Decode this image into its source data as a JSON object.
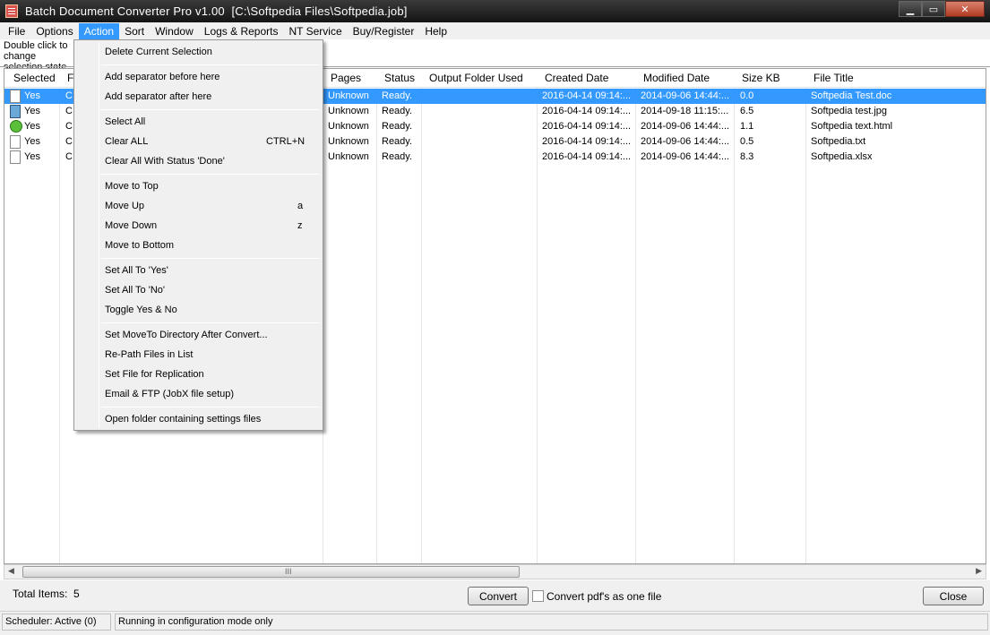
{
  "window": {
    "title": "Batch Document Converter Pro v1.00  [C:\\Softpedia Files\\Softpedia.job]",
    "minimize": "▁",
    "maximize": "▭",
    "close": "✕"
  },
  "menu": [
    "File",
    "Options",
    "Action",
    "Sort",
    "Window",
    "Logs & Reports",
    "NT Service",
    "Buy/Register",
    "Help"
  ],
  "hint": "Double click to change selection state",
  "columns": {
    "selected": "Selected",
    "file": "F",
    "pages": "Pages",
    "status": "Status",
    "output": "Output Folder Used",
    "created": "Created Date",
    "modified": "Modified Date",
    "size": "Size KB",
    "title": "File Title"
  },
  "rows": [
    {
      "selected": "Yes",
      "file": "C:",
      "pages": "Unknown",
      "status": "Ready.",
      "output": "",
      "created": "2016-04-14 09:14:...",
      "modified": "2014-09-06 14:44:...",
      "size": "0.0",
      "title": "Softpedia Test.doc",
      "icon": "doc-icon"
    },
    {
      "selected": "Yes",
      "file": "C:",
      "pages": "Unknown",
      "status": "Ready.",
      "output": "",
      "created": "2016-04-14 09:14:...",
      "modified": "2014-09-18 11:15:...",
      "size": "6.5",
      "title": "Softpedia test.jpg",
      "icon": "image-icon"
    },
    {
      "selected": "Yes",
      "file": "C:",
      "pages": "Unknown",
      "status": "Ready.",
      "output": "",
      "created": "2016-04-14 09:14:...",
      "modified": "2014-09-06 14:44:...",
      "size": "1.1",
      "title": "Softpedia text.html",
      "icon": "html-icon"
    },
    {
      "selected": "Yes",
      "file": "C:",
      "pages": "Unknown",
      "status": "Ready.",
      "output": "",
      "created": "2016-04-14 09:14:...",
      "modified": "2014-09-06 14:44:...",
      "size": "0.5",
      "title": "Softpedia.txt",
      "icon": "text-icon"
    },
    {
      "selected": "Yes",
      "file": "C:",
      "pages": "Unknown",
      "status": "Ready.",
      "output": "",
      "created": "2016-04-14 09:14:...",
      "modified": "2014-09-06 14:44:...",
      "size": "8.3",
      "title": "Softpedia.xlsx",
      "icon": "sheet-icon"
    }
  ],
  "scroll_grip": "III",
  "footer": {
    "total_label": "Total Items:",
    "total_value": "5",
    "convert": "Convert",
    "convert_pdf": "Convert pdf's as one file",
    "close": "Close"
  },
  "status": {
    "scheduler": "Scheduler: Active (0)",
    "mode": "Running in configuration mode only"
  },
  "action_menu": {
    "delete_selection": "Delete Current Selection",
    "sep_before": "Add separator before here",
    "sep_after": "Add separator after here",
    "select_all": "Select All",
    "clear_all": "Clear ALL",
    "clear_all_key": "CTRL+N",
    "clear_done": "Clear All With Status 'Done'",
    "move_top": "Move to Top",
    "move_up": "Move Up",
    "move_up_key": "a",
    "move_down": "Move Down",
    "move_down_key": "z",
    "move_bottom": "Move to Bottom",
    "set_yes": "Set All To 'Yes'",
    "set_no": "Set All To 'No'",
    "toggle": "Toggle Yes & No",
    "moveto_dir": "Set MoveTo Directory After Convert...",
    "repath": "Re-Path Files in List",
    "replication": "Set File for Replication",
    "email_ftp": "Email & FTP (JobX file setup)",
    "open_folder": "Open folder containing settings files"
  },
  "colors": {
    "selection": "#3399ff",
    "titlebar": "#1e1e1e",
    "menubar": "#f0f0f0"
  }
}
